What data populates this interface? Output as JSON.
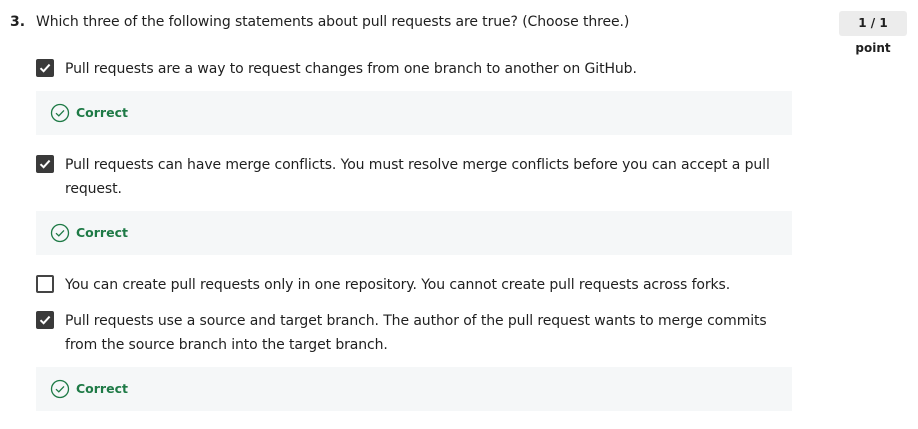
{
  "question": {
    "number": "3.",
    "text": "Which three of the following statements about pull requests are true? (Choose three.)",
    "points": "1 / 1 point"
  },
  "options": [
    {
      "checked": true,
      "text": "Pull requests are a way to request changes from one branch to another on GitHub.",
      "feedback": "Correct"
    },
    {
      "checked": true,
      "text": "Pull requests can have merge conflicts. You must resolve merge conflicts before you can accept a pull request.",
      "feedback": "Correct"
    },
    {
      "checked": false,
      "text": "You can create pull requests only in one repository. You cannot create pull requests across forks.",
      "feedback": ""
    },
    {
      "checked": true,
      "text": "Pull requests use a source and target branch. The author of the pull request wants to merge commits from the source branch into the target branch.",
      "feedback": "Correct"
    }
  ],
  "colors": {
    "correct_text": "#1e7a46",
    "feedback_bg": "#f5f7f8",
    "checkbox_fill": "#3a3a3a"
  },
  "icons": {
    "checkbox_checked": "checkmark-icon",
    "feedback": "check-circle-icon"
  }
}
